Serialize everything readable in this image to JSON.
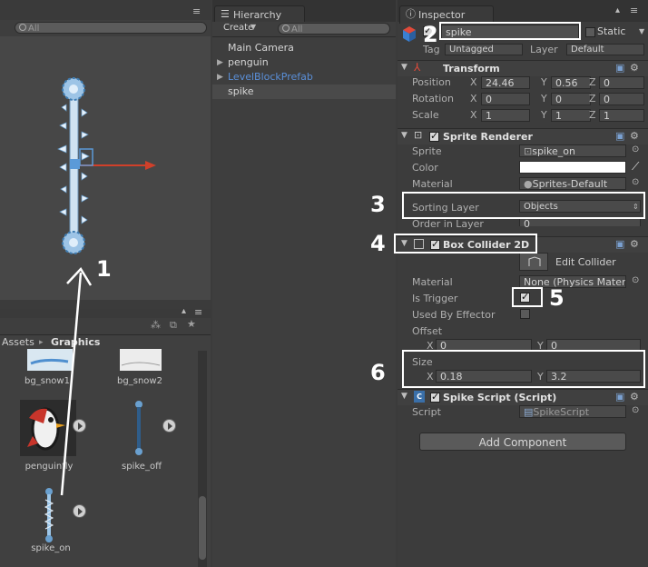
{
  "scene": {
    "search_placeholder": "All"
  },
  "hierarchy": {
    "tab": "Hierarchy",
    "create": "Create",
    "search_placeholder": "All",
    "items": [
      {
        "label": "Main Camera"
      },
      {
        "label": "penguin"
      },
      {
        "label": "LevelBlockPrefab"
      },
      {
        "label": "spike"
      }
    ]
  },
  "project": {
    "breadcrumb_root": "Assets",
    "breadcrumb_folder": "Graphics",
    "assets": [
      {
        "label": "bg_snow1"
      },
      {
        "label": "bg_snow2"
      },
      {
        "label": "penguinfly"
      },
      {
        "label": "spike_off"
      },
      {
        "label": "spike_on"
      }
    ]
  },
  "inspector": {
    "tab": "Inspector",
    "name": "spike",
    "static": "Static",
    "tag_label": "Tag",
    "tag_value": "Untagged",
    "layer_label": "Layer",
    "layer_value": "Default",
    "transform": {
      "title": "Transform",
      "position_label": "Position",
      "rotation_label": "Rotation",
      "scale_label": "Scale",
      "axis_x": "X",
      "axis_y": "Y",
      "axis_z": "Z",
      "position": [
        "24.46",
        "0.56",
        "0"
      ],
      "rotation": [
        "0",
        "0",
        "0"
      ],
      "scale": [
        "1",
        "1",
        "1"
      ]
    },
    "sprite_renderer": {
      "title": "Sprite Renderer",
      "sprite_label": "Sprite",
      "sprite_value": "spike_on",
      "color_label": "Color",
      "material_label": "Material",
      "material_value": "Sprites-Default",
      "sorting_layer_label": "Sorting Layer",
      "sorting_layer_value": "Objects",
      "order_label": "Order in Layer",
      "order_value": "0"
    },
    "box_collider": {
      "title": "Box Collider 2D",
      "edit_collider": "Edit Collider",
      "material_label": "Material",
      "material_value": "None (Physics Mater",
      "is_trigger_label": "Is Trigger",
      "used_by_effector_label": "Used By Effector",
      "offset_label": "Offset",
      "offset_x": "0",
      "offset_y": "0",
      "size_label": "Size",
      "size_x": "0.18",
      "size_y": "3.2",
      "axis_x": "X",
      "axis_y": "Y"
    },
    "spike_script": {
      "title": "Spike Script (Script)",
      "script_label": "Script",
      "script_value": "SpikeScript"
    },
    "add_component": "Add Component"
  },
  "annotations": [
    "1",
    "2",
    "3",
    "4",
    "5",
    "6"
  ],
  "colors": {
    "annotation": "#ffffff",
    "transform_arrow_x": "#d0402a",
    "selection": "#4a4a4a",
    "prefab_text": "#5a8fd8"
  }
}
